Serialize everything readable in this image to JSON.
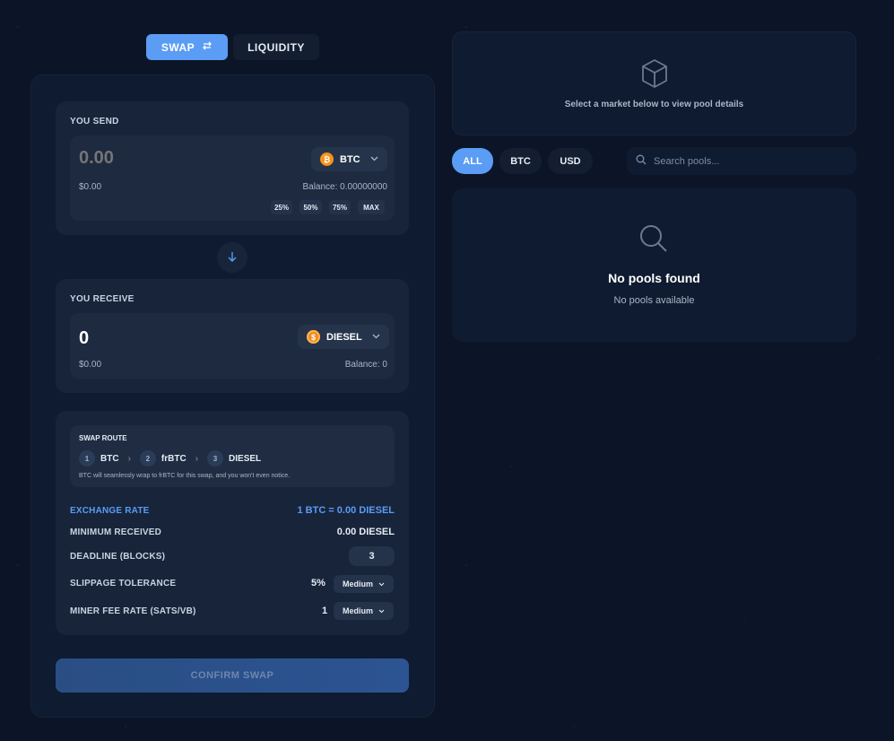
{
  "tabs": {
    "swap": "SWAP",
    "liquidity": "LIQUIDITY"
  },
  "send": {
    "label": "YOU SEND",
    "amount_placeholder": "0.00",
    "token": "BTC",
    "token_icon_glyph": "₿",
    "usd": "$0.00",
    "balance": "Balance: 0.00000000",
    "percent_buttons": [
      "25%",
      "50%",
      "75%",
      "MAX"
    ]
  },
  "receive": {
    "label": "YOU RECEIVE",
    "amount": "0",
    "token": "DIESEL",
    "token_icon_glyph": "$",
    "usd": "$0.00",
    "balance": "Balance: 0"
  },
  "route": {
    "title": "SWAP ROUTE",
    "steps": [
      {
        "num": "1",
        "name": "BTC"
      },
      {
        "num": "2",
        "name": "frBTC"
      },
      {
        "num": "3",
        "name": "DIESEL"
      }
    ],
    "note": "BTC will seamlessly wrap to frBTC for this swap, and you won't even notice."
  },
  "details": {
    "exchange_rate_label": "EXCHANGE RATE",
    "exchange_rate_value": "1 BTC = 0.00 DIESEL",
    "min_received_label": "MINIMUM RECEIVED",
    "min_received_value": "0.00 DIESEL",
    "deadline_label": "DEADLINE (BLOCKS)",
    "deadline_value": "3",
    "slippage_label": "SLIPPAGE TOLERANCE",
    "slippage_value": "5%",
    "slippage_mode": "Medium",
    "fee_label": "MINER FEE RATE (SATS/VB)",
    "fee_value": "1",
    "fee_mode": "Medium"
  },
  "confirm_label": "CONFIRM SWAP",
  "market": {
    "hint": "Select a market below to view pool details"
  },
  "filters": [
    "ALL",
    "BTC",
    "USD"
  ],
  "search": {
    "placeholder": "Search pools..."
  },
  "pools": {
    "empty_title": "No pools found",
    "empty_subtitle": "No pools available"
  },
  "colors": {
    "accent": "#5b9cf5",
    "background": "#0b1527",
    "card": "#0f1b30"
  }
}
